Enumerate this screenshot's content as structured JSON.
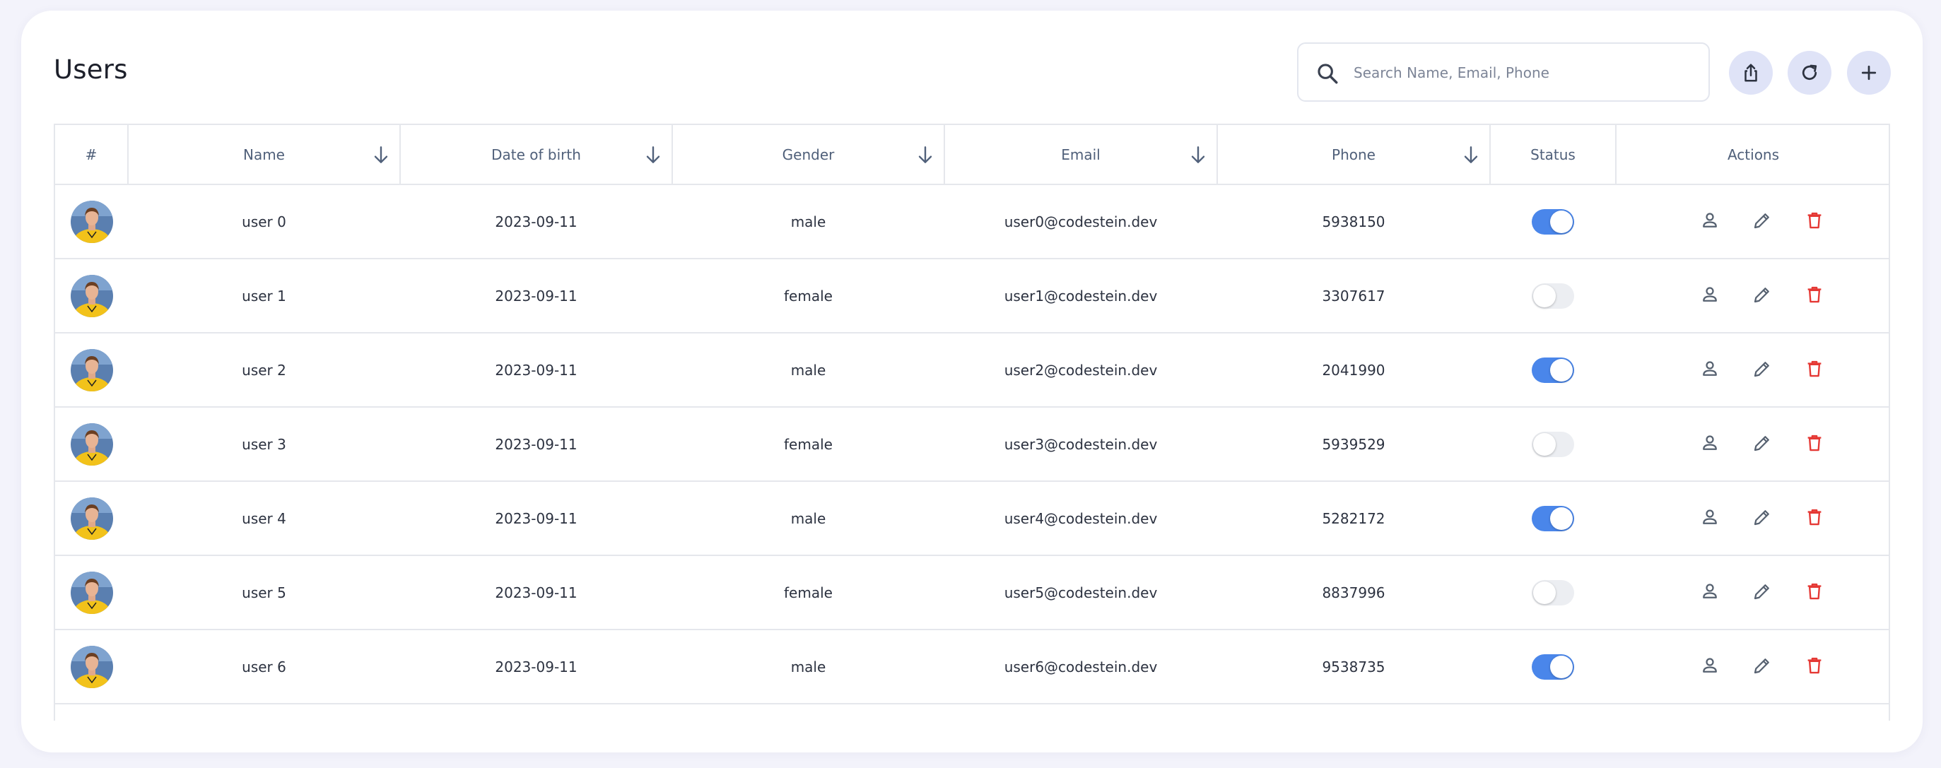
{
  "page": {
    "title": "Users"
  },
  "search": {
    "placeholder": "Search Name, Email, Phone",
    "value": ""
  },
  "toolbar": {
    "export_icon": "share-icon",
    "refresh_icon": "refresh-icon",
    "add_icon": "plus-icon"
  },
  "colors": {
    "accent": "#4a86ea",
    "danger": "#e53935",
    "button_bg": "#dfe3f7"
  },
  "table": {
    "columns": [
      "#",
      "Name",
      "Date of birth",
      "Gender",
      "Email",
      "Phone",
      "Status",
      "Actions"
    ],
    "rows": [
      {
        "name": "user 0",
        "dob": "2023-09-11",
        "gender": "male",
        "email": "user0@codestein.dev",
        "phone": "5938150",
        "active": true
      },
      {
        "name": "user 1",
        "dob": "2023-09-11",
        "gender": "female",
        "email": "user1@codestein.dev",
        "phone": "3307617",
        "active": false
      },
      {
        "name": "user 2",
        "dob": "2023-09-11",
        "gender": "male",
        "email": "user2@codestein.dev",
        "phone": "2041990",
        "active": true
      },
      {
        "name": "user 3",
        "dob": "2023-09-11",
        "gender": "female",
        "email": "user3@codestein.dev",
        "phone": "5939529",
        "active": false
      },
      {
        "name": "user 4",
        "dob": "2023-09-11",
        "gender": "male",
        "email": "user4@codestein.dev",
        "phone": "5282172",
        "active": true
      },
      {
        "name": "user 5",
        "dob": "2023-09-11",
        "gender": "female",
        "email": "user5@codestein.dev",
        "phone": "8837996",
        "active": false
      },
      {
        "name": "user 6",
        "dob": "2023-09-11",
        "gender": "male",
        "email": "user6@codestein.dev",
        "phone": "9538735",
        "active": true
      }
    ]
  }
}
